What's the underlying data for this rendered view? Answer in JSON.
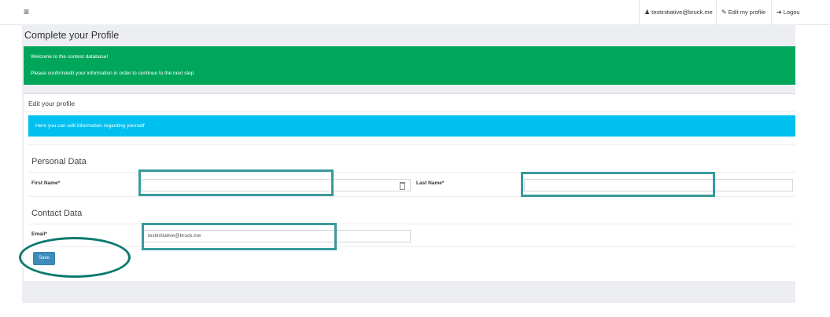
{
  "header": {
    "menu_icon": "hamburger-icon",
    "user_icon": "user-icon",
    "user_email": "testinitiative@bruck.me",
    "edit_icon": "edit-icon",
    "edit_profile": "Edit my profile",
    "logout_icon": "logout-icon",
    "logout": "Logou"
  },
  "page": {
    "title": "Complete your Profile",
    "welcome_line1": "Welcome to the contest database!",
    "welcome_line2": "Please confirm/edit your information in order to continue to the next step"
  },
  "card": {
    "title": "Edit your profile",
    "info": "Here you can edit information regarding yourself"
  },
  "personal": {
    "heading": "Personal Data",
    "first_name_label": "First Name*",
    "first_name_value": "",
    "first_name_icon": "calendar-icon",
    "last_name_label": "Last Name*",
    "last_name_value": ""
  },
  "contact": {
    "heading": "Contact Data",
    "email_label": "Email*",
    "email_value": "testinitiative@bruck.me"
  },
  "actions": {
    "save": "Save"
  },
  "colors": {
    "success": "#00a65a",
    "info": "#00c0ef",
    "primary": "#3c8dbc",
    "highlight": "#3a9a9b"
  }
}
